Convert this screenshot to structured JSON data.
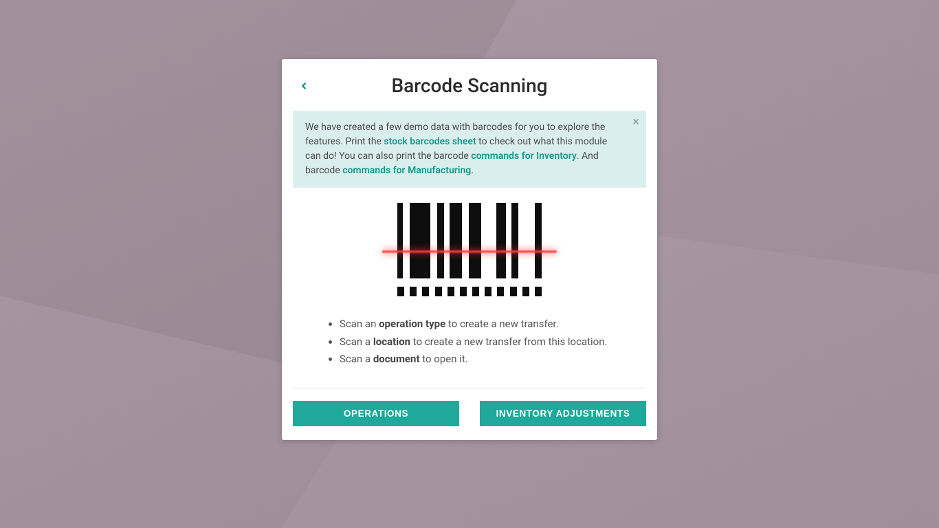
{
  "title": "Barcode Scanning",
  "alert": {
    "pre_text": "We have created a few demo data with barcodes for you to explore the features. Print the ",
    "link1": "stock barcodes sheet",
    "mid1": " to check out what this module can do! You can also print the barcode ",
    "link2": "commands for Inventory",
    "mid2": ". And barcode ",
    "link3": "commands for Manufacturing",
    "end": "."
  },
  "tips": {
    "t1_pre": "Scan an ",
    "t1_strong": "operation type",
    "t1_post": " to create a new transfer.",
    "t2_pre": "Scan a ",
    "t2_strong": "location",
    "t2_post": " to create a new transfer from this location.",
    "t3_pre": "Scan a ",
    "t3_strong": "document",
    "t3_post": " to open it."
  },
  "buttons": {
    "operations": "Operations",
    "inventory_adjustments": "Inventory Adjustments"
  }
}
